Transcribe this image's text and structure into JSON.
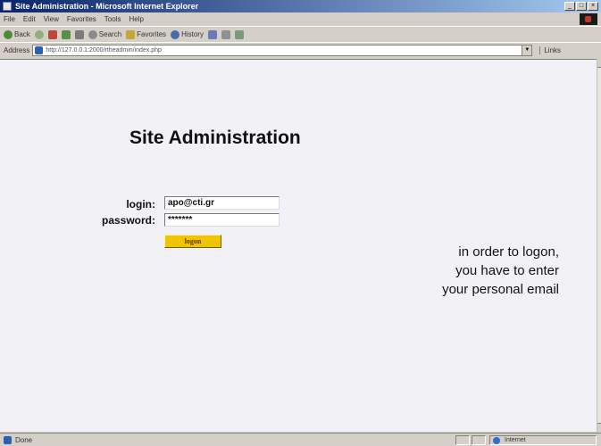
{
  "window": {
    "title": "Site Administration - Microsoft Internet Explorer",
    "buttons": {
      "minimize": "_",
      "maximize": "□",
      "close": "×"
    }
  },
  "menubar": {
    "items": [
      "File",
      "Edit",
      "View",
      "Favorites",
      "Tools",
      "Help"
    ]
  },
  "toolbar": {
    "back": "Back",
    "forward": "",
    "stop": "",
    "refresh": "",
    "home": "",
    "search": "Search",
    "favorites": "Favorites",
    "history": "History"
  },
  "addressbar": {
    "label": "Address",
    "url": "http://127.0.0.1:2000/rtheadmin/index.php",
    "links": "Links"
  },
  "page": {
    "title": "Site Administration",
    "login_label": "login:",
    "login_value": "apo@cti.gr",
    "password_label": "password:",
    "password_value": "*******",
    "logon_button": "logon",
    "note_lines": [
      "in order to logon,",
      "you have to enter",
      "your personal email"
    ]
  },
  "statusbar": {
    "text": "Done",
    "zone": "Internet"
  }
}
